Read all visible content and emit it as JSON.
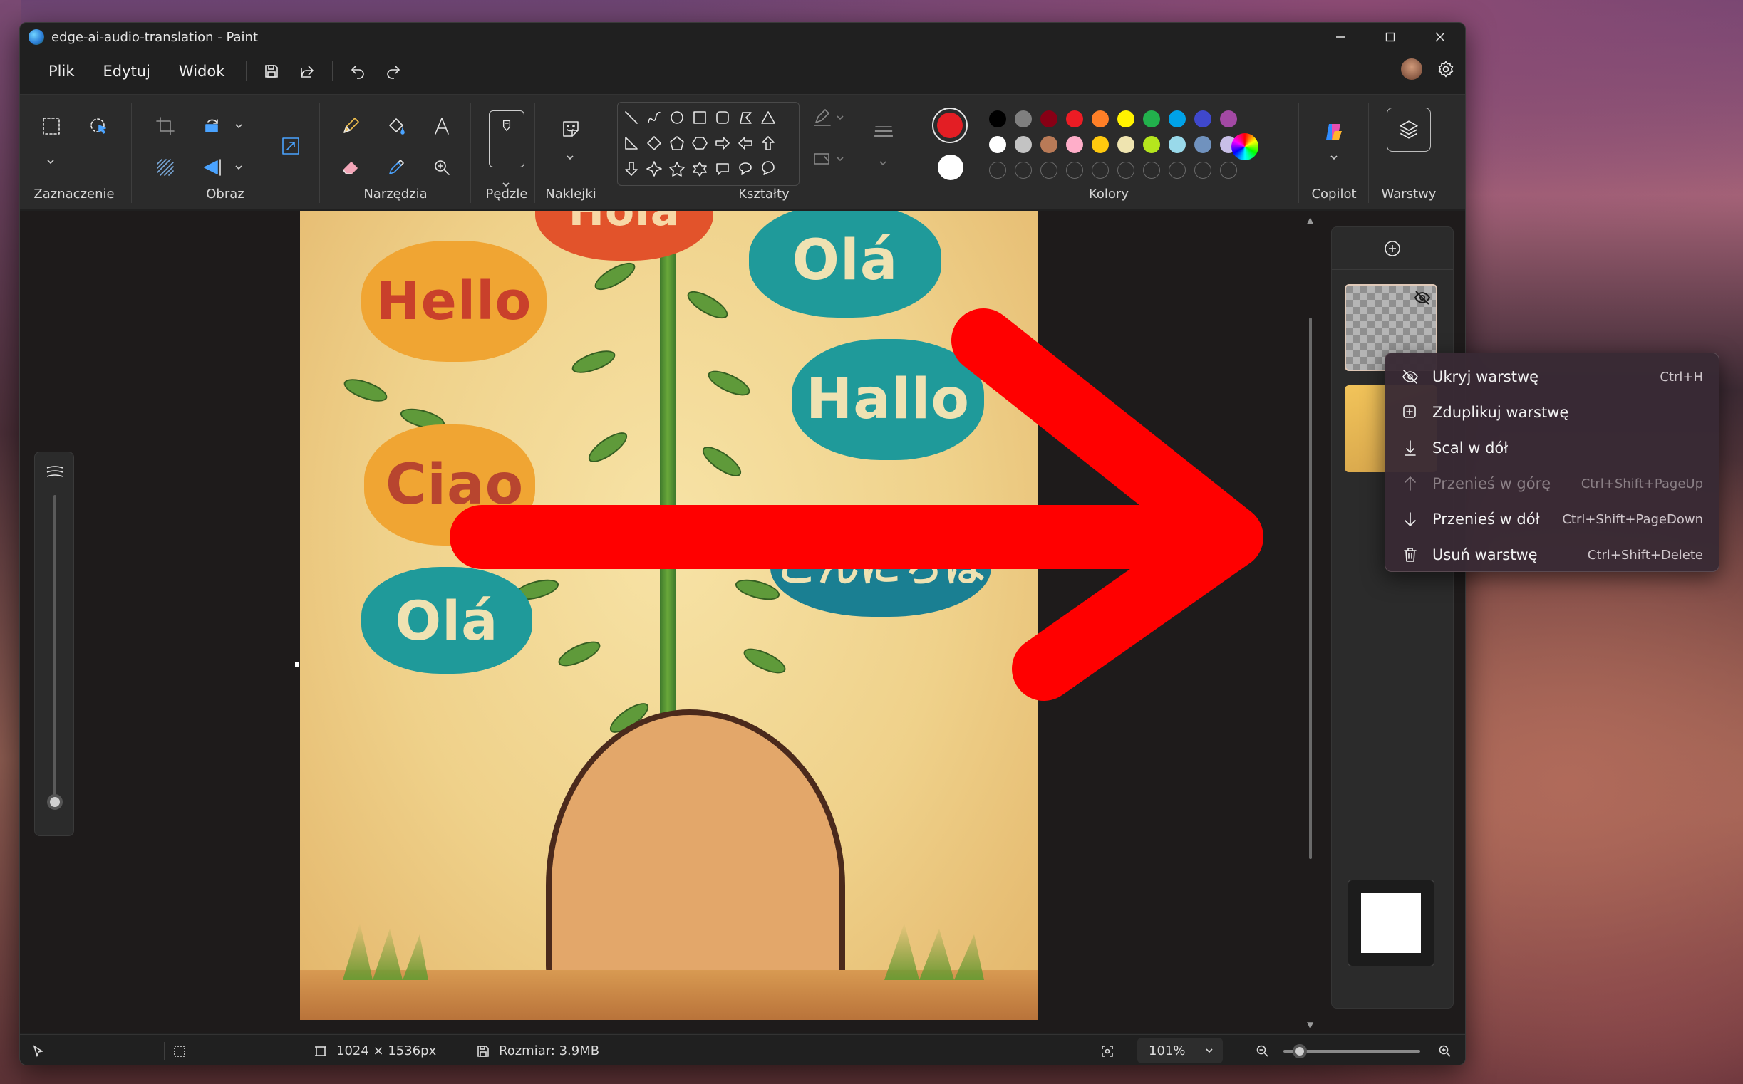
{
  "window": {
    "title": "edge-ai-audio-translation - Paint"
  },
  "menu": {
    "file": "Plik",
    "edit": "Edytuj",
    "view": "Widok"
  },
  "ribbon": {
    "selection": "Zaznaczenie",
    "image": "Obraz",
    "tools": "Narzędzia",
    "brushes": "Pędzle",
    "stickers": "Naklejki",
    "shapes": "Kształty",
    "colors": "Kolory",
    "copilot": "Copilot",
    "layers": "Warstwy"
  },
  "colors": {
    "primary": "#e31e24",
    "secondary": "#ffffff",
    "row1": [
      "#000000",
      "#7f7f7f",
      "#880015",
      "#ed1c24",
      "#ff7f27",
      "#fff200",
      "#22b14c",
      "#00a2e8",
      "#3f48cc",
      "#a349a4"
    ],
    "row2": [
      "#ffffff",
      "#c3c3c3",
      "#b97a57",
      "#ffaec9",
      "#ffc90e",
      "#efe4b0",
      "#b5e61d",
      "#99d9ea",
      "#7092be",
      "#c8bfe7"
    ]
  },
  "canvas_art": {
    "bubbles": [
      "Hola",
      "Hello",
      "Olá",
      "Hallo",
      "Ciao",
      "こんにちは",
      "Olá"
    ]
  },
  "context_menu": {
    "items": [
      {
        "label": "Ukryj warstwę",
        "shortcut": "Ctrl+H",
        "icon": "eye-off-icon",
        "disabled": false
      },
      {
        "label": "Zduplikuj warstwę",
        "shortcut": "",
        "icon": "duplicate-icon",
        "disabled": false
      },
      {
        "label": "Scal w dół",
        "shortcut": "",
        "icon": "merge-down-icon",
        "disabled": false
      },
      {
        "label": "Przenieś w górę",
        "shortcut": "Ctrl+Shift+PageUp",
        "icon": "arrow-up-icon",
        "disabled": true
      },
      {
        "label": "Przenieś w dół",
        "shortcut": "Ctrl+Shift+PageDown",
        "icon": "arrow-down-icon",
        "disabled": false
      },
      {
        "label": "Usuń warstwę",
        "shortcut": "Ctrl+Shift+Delete",
        "icon": "trash-icon",
        "disabled": false
      }
    ]
  },
  "status": {
    "dimensions": "1024 × 1536px",
    "size": "Rozmiar: 3.9MB",
    "zoom": "101%",
    "zoom_level": 0.12
  }
}
